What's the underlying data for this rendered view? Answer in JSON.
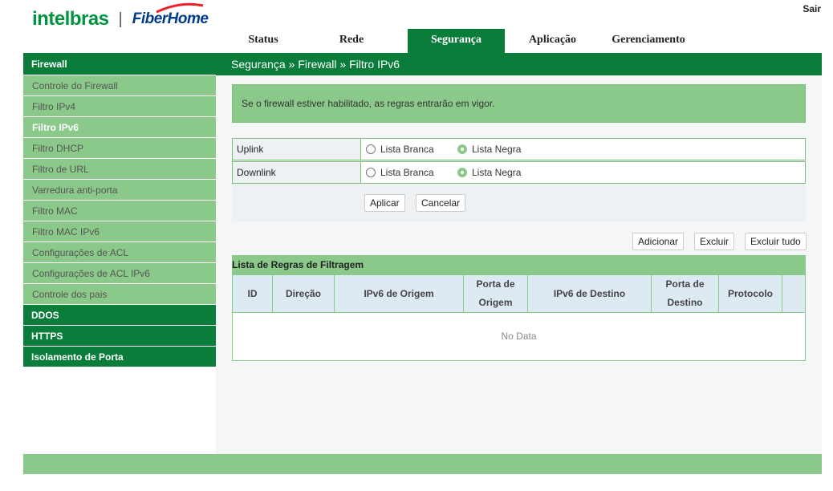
{
  "header": {
    "logo_brand": "intelbras",
    "logo_separator": "|",
    "logo_partner": "FiberHome",
    "logout_label": "Sair"
  },
  "nav": {
    "tabs": [
      {
        "label": "Status"
      },
      {
        "label": "Rede"
      },
      {
        "label": "Segurança"
      },
      {
        "label": "Aplicação"
      },
      {
        "label": "Gerenciamento"
      }
    ],
    "active": "Segurança"
  },
  "breadcrumb": "Segurança » Firewall » Filtro IPv6",
  "sidebar": {
    "firewall": "Firewall",
    "items": [
      {
        "label": "Controle do Firewall"
      },
      {
        "label": "Filtro IPv4"
      },
      {
        "label": "Filtro IPv6"
      },
      {
        "label": "Filtro DHCP"
      },
      {
        "label": "Filtro de URL"
      },
      {
        "label": "Varredura anti-porta"
      },
      {
        "label": "Filtro MAC"
      },
      {
        "label": "Filtro MAC IPv6"
      },
      {
        "label": "Configurações de ACL"
      },
      {
        "label": "Configurações de ACL IPv6"
      },
      {
        "label": "Controle dos pais"
      }
    ],
    "active_item": "Filtro IPv6",
    "sections": [
      {
        "label": "DDOS"
      },
      {
        "label": "HTTPS"
      },
      {
        "label": "Isolamento de Porta"
      }
    ]
  },
  "notice": "Se o firewall estiver habilitado, as regras entrarão em vigor.",
  "form": {
    "uplink": {
      "label": "Uplink",
      "option_white": "Lista Branca",
      "option_black": "Lista Negra",
      "selected": "Lista Negra"
    },
    "downlink": {
      "label": "Downlink",
      "option_white": "Lista Branca",
      "option_black": "Lista Negra",
      "selected": "Lista Negra"
    },
    "apply_label": "Aplicar",
    "cancel_label": "Cancelar"
  },
  "table_actions": {
    "add_label": "Adicionar",
    "delete_label": "Excluir",
    "delete_all_label": "Excluir tudo"
  },
  "table": {
    "title": "Lista de Regras de Filtragem",
    "columns": [
      "ID",
      "Direção",
      "IPv6 de Origem",
      "Porta de Origem",
      "IPv6 de Destino",
      "Porta de Destino",
      "Protocolo",
      ""
    ],
    "empty_text": "No Data"
  },
  "colors": {
    "primary_green": "#0b7d3b",
    "light_green": "#8bc98a",
    "table_header_bg": "#deeaf2",
    "content_bg": "#f5f6f8"
  }
}
